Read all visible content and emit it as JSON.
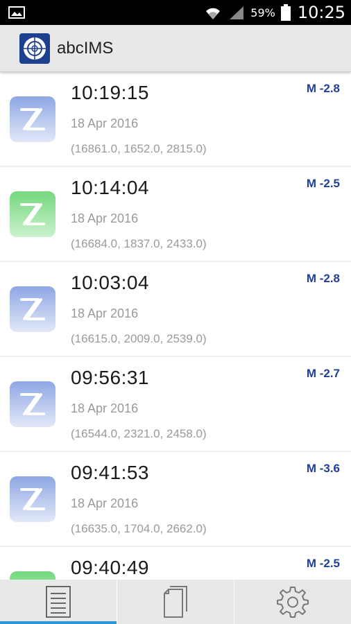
{
  "status_bar": {
    "battery_percent": "59%",
    "time": "10:25"
  },
  "app": {
    "title": "abcIMS",
    "logo_icon": "crosshair-target-icon"
  },
  "events": [
    {
      "time": "10:19:15",
      "date": "18 Apr 2016",
      "coords": "(16861.0, 1652.0, 2815.0)",
      "magnitude": "M -2.8",
      "icon_color": "blue"
    },
    {
      "time": "10:14:04",
      "date": "18 Apr 2016",
      "coords": "(16684.0, 1837.0, 2433.0)",
      "magnitude": "M -2.5",
      "icon_color": "green"
    },
    {
      "time": "10:03:04",
      "date": "18 Apr 2016",
      "coords": "(16615.0, 2009.0, 2539.0)",
      "magnitude": "M -2.8",
      "icon_color": "blue"
    },
    {
      "time": "09:56:31",
      "date": "18 Apr 2016",
      "coords": "(16544.0, 2321.0, 2458.0)",
      "magnitude": "M -2.7",
      "icon_color": "blue"
    },
    {
      "time": "09:41:53",
      "date": "18 Apr 2016",
      "coords": "(16635.0, 1704.0, 2662.0)",
      "magnitude": "M -3.6",
      "icon_color": "blue"
    },
    {
      "time": "09:40:49",
      "date": "",
      "coords": "",
      "magnitude": "M -2.5",
      "icon_color": "green"
    }
  ],
  "tabs": [
    {
      "icon": "list-document-icon",
      "selected": true
    },
    {
      "icon": "copy-pages-icon",
      "selected": false
    },
    {
      "icon": "gear-icon",
      "selected": false
    }
  ],
  "colors": {
    "accent": "#2a96d6",
    "magnitude": "#1f3f9a",
    "icon_blue_top": "#8ea6e4",
    "icon_blue_bottom": "#e2e8f8",
    "icon_green_top": "#74d87e",
    "icon_green_bottom": "#cdf2cf"
  }
}
